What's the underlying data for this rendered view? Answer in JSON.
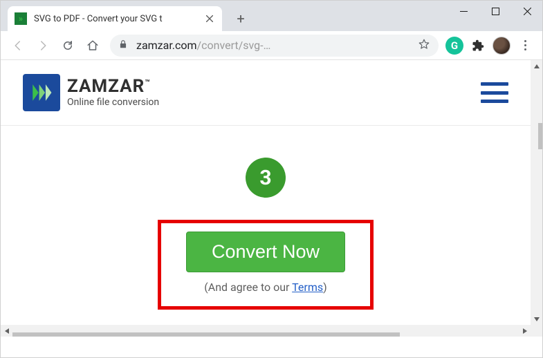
{
  "window": {
    "tab_title": "SVG to PDF - Convert your SVG t",
    "url_host": "zamzar.com",
    "url_path": "/convert/svg-…"
  },
  "toolbar_ext": {
    "grammarly_initial": "G"
  },
  "logo": {
    "brand": "ZAMZAR",
    "tm": "™",
    "tagline": "Online file conversion"
  },
  "step": {
    "number": "3"
  },
  "convert": {
    "button_label": "Convert Now",
    "agree_prefix": "(And agree to our ",
    "terms_label": "Terms",
    "agree_suffix": ")"
  }
}
